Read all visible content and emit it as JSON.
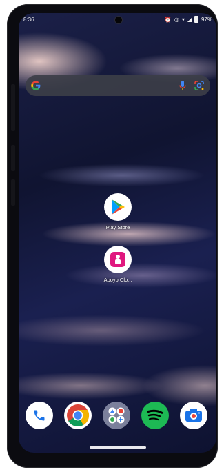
{
  "status_bar": {
    "time": "8:36",
    "battery_text": "97%"
  },
  "search_bar": {
    "logo_icon": "google-g-icon",
    "mic_icon": "mic-icon",
    "lens_icon": "google-lens-icon"
  },
  "apps": [
    {
      "label": "Play Store",
      "icon": "play-store-icon"
    },
    {
      "label": "Apoyo Clo...",
      "icon": "apoyo-app-icon"
    }
  ],
  "dock": [
    {
      "icon": "phone-icon"
    },
    {
      "icon": "chrome-icon"
    },
    {
      "icon": "app-folder-icon"
    },
    {
      "icon": "spotify-icon"
    },
    {
      "icon": "camera-icon"
    }
  ],
  "colors": {
    "wallpaper_base": "#101431",
    "spotify": "#1db954",
    "apoyo": "#e0187f",
    "google_blue": "#4285f4",
    "google_red": "#ea4335",
    "google_yellow": "#fbbc05",
    "google_green": "#34a853"
  }
}
